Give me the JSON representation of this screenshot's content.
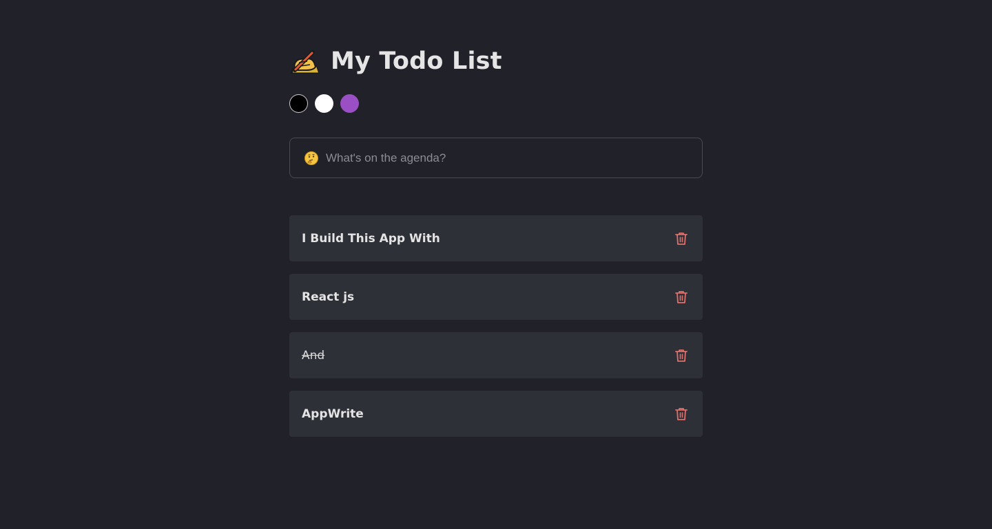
{
  "header": {
    "title": "My Todo List",
    "icon": "writing-hand-icon"
  },
  "theme_swatches": [
    {
      "name": "black-theme",
      "color": "#000000"
    },
    {
      "name": "white-theme",
      "color": "#ffffff"
    },
    {
      "name": "purple-theme",
      "color": "#9a4fc4"
    }
  ],
  "search": {
    "icon": "thinking-face-icon",
    "placeholder": "What's on the agenda?",
    "value": ""
  },
  "todos": [
    {
      "text": "I Build This App With",
      "completed": false
    },
    {
      "text": "React js",
      "completed": false
    },
    {
      "text": "And",
      "completed": true
    },
    {
      "text": "AppWrite",
      "completed": false
    }
  ],
  "colors": {
    "background": "#21212a",
    "item_background": "#2e3038",
    "delete_icon": "#e0706b"
  }
}
